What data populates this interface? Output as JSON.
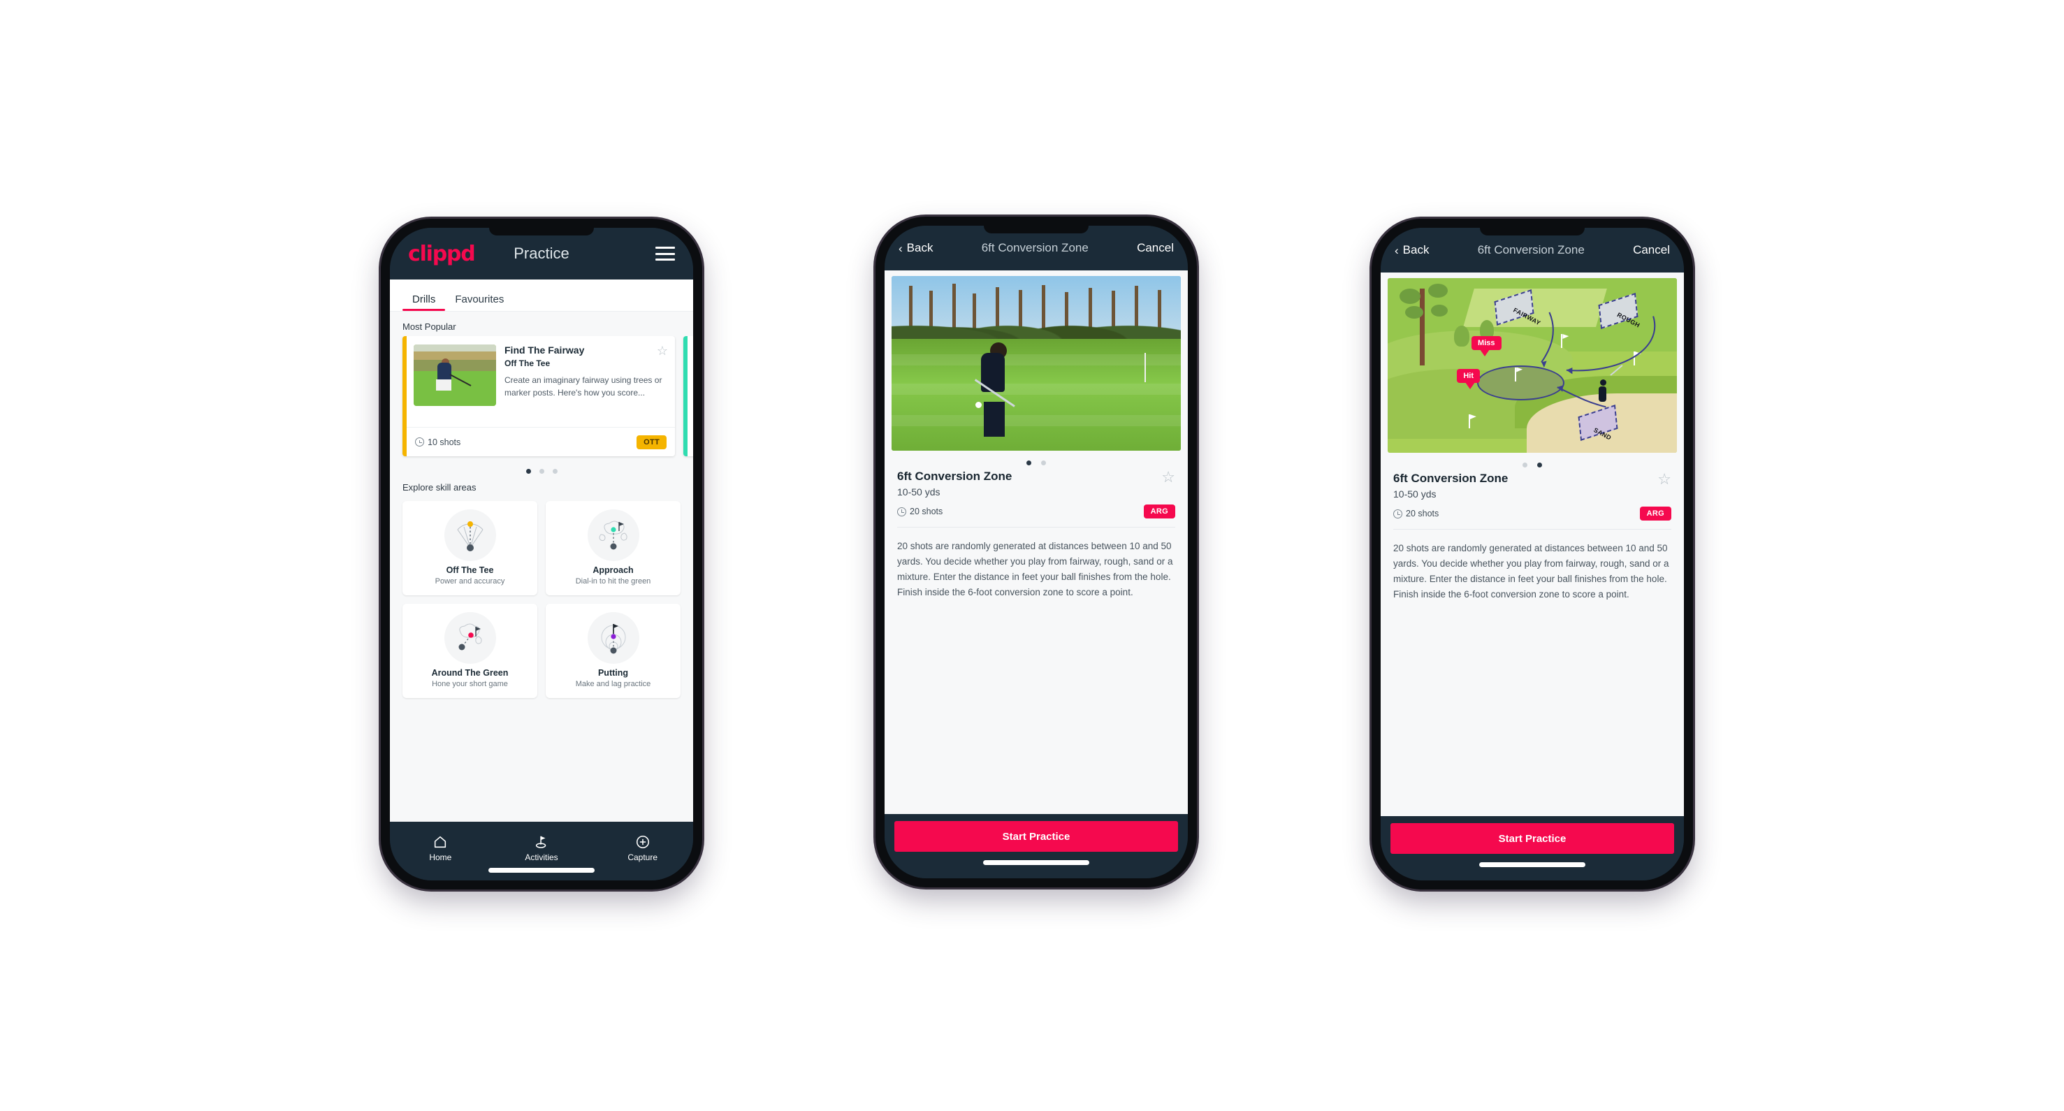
{
  "phone1": {
    "header": {
      "brand": "clippd",
      "title": "Practice",
      "menu_icon": "hamburger-icon"
    },
    "tabs": [
      {
        "label": "Drills",
        "active": true
      },
      {
        "label": "Favourites",
        "active": false
      }
    ],
    "sections": {
      "popular_title": "Most Popular",
      "skills_title": "Explore skill areas"
    },
    "popular_card": {
      "name": "Find The Fairway",
      "category": "Off The Tee",
      "description": "Create an imaginary fairway using trees or marker posts. Here's how you score...",
      "shots": "10 shots",
      "chip": "OTT",
      "chip_color": "#f5b400",
      "accent_color": "#f5b400",
      "next_accent_color": "#2fdcb0",
      "favourite_icon": "star-outline-icon"
    },
    "carousel_dots": {
      "count": 3,
      "active": 0
    },
    "skills": [
      {
        "name": "Off The Tee",
        "desc": "Power and accuracy",
        "dot_color": "#f5b400",
        "icon": "tee-dispersion-icon"
      },
      {
        "name": "Approach",
        "desc": "Dial-in to hit the green",
        "dot_color": "#2fdcb0",
        "icon": "approach-green-icon"
      },
      {
        "name": "Around The Green",
        "desc": "Hone your short game",
        "dot_color": "#f5094e",
        "icon": "around-green-icon"
      },
      {
        "name": "Putting",
        "desc": "Make and lag practice",
        "dot_color": "#8b1fd6",
        "icon": "putting-rings-icon"
      }
    ],
    "bottom_nav": [
      {
        "label": "Home",
        "icon": "home-icon",
        "active": false
      },
      {
        "label": "Activities",
        "icon": "golf-flag-icon",
        "active": true
      },
      {
        "label": "Capture",
        "icon": "plus-circle-icon",
        "active": false
      }
    ]
  },
  "phone2": {
    "header": {
      "back": "Back",
      "title": "6ft Conversion Zone",
      "cancel": "Cancel",
      "back_icon": "chevron-left-icon"
    },
    "media_type": "photo",
    "dots": {
      "count": 2,
      "active": 0
    },
    "detail": {
      "name": "6ft Conversion Zone",
      "yards": "10-50 yds",
      "shots": "20 shots",
      "chip": "ARG",
      "chip_color": "#f5094e",
      "favourite_icon": "star-outline-icon",
      "description": "20 shots are randomly generated at distances between 10 and 50 yards. You decide whether you play from fairway, rough, sand or a mixture. Enter the distance in feet your ball finishes from the hole. Finish inside the 6-foot conversion zone to score a point."
    },
    "cta": "Start Practice"
  },
  "phone3": {
    "header": {
      "back": "Back",
      "title": "6ft Conversion Zone",
      "cancel": "Cancel",
      "back_icon": "chevron-left-icon"
    },
    "media_type": "illustration",
    "illustration": {
      "labels": {
        "fairway": "FAIRWAY",
        "rough": "ROUGH",
        "sand": "SAND"
      },
      "bubbles": {
        "miss": "Miss",
        "hit": "Hit"
      },
      "accent": "#3b3f8f",
      "bubble_color": "#f5094e"
    },
    "dots": {
      "count": 2,
      "active": 1
    },
    "detail": {
      "name": "6ft Conversion Zone",
      "yards": "10-50 yds",
      "shots": "20 shots",
      "chip": "ARG",
      "chip_color": "#f5094e",
      "favourite_icon": "star-outline-icon",
      "description": "20 shots are randomly generated at distances between 10 and 50 yards. You decide whether you play from fairway, rough, sand or a mixture. Enter the distance in feet your ball finishes from the hole. Finish inside the 6-foot conversion zone to score a point."
    },
    "cta": "Start Practice"
  }
}
